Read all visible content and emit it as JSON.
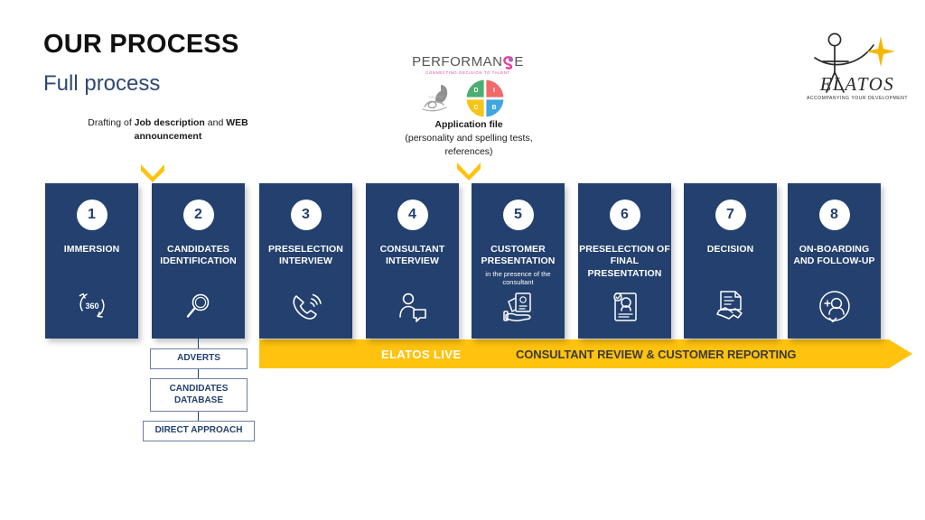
{
  "header": {
    "title": "OUR PROCESS",
    "subtitle": "Full process"
  },
  "notes": {
    "drafting": {
      "part1": "Drafting of ",
      "bold1": "Job description",
      "part2": " and ",
      "bold2": "WEB announcement"
    },
    "application": {
      "title": "Application file",
      "detail": "(personality and spelling tests, references)"
    }
  },
  "logos": {
    "performanse": {
      "wordmark": "PERFORMAN",
      "wordmark_end": "E",
      "tagline": "CONNECTING DECISION TO TALENT",
      "swirl_color": "#E5429B"
    },
    "disc": {
      "quadrants": [
        {
          "letter": "D",
          "color": "#4CAF72"
        },
        {
          "letter": "I",
          "color": "#F06A6A"
        },
        {
          "letter": "C",
          "color": "#F5C518"
        },
        {
          "letter": "B",
          "color": "#40A6E0"
        }
      ]
    },
    "script_logo": "Telfor",
    "elatos": {
      "name": "ELATOS",
      "tagline": "ACCOMPANYING YOUR DEVELOPMENT",
      "star_color": "#F5B800"
    }
  },
  "colors": {
    "navy": "#23406E",
    "yellow": "#FFC20E",
    "subtitle_blue": "#2e4a73"
  },
  "steps": [
    {
      "number": "1",
      "label": "IMMERSION",
      "sublabel": "",
      "icon": "rotate-360-icon"
    },
    {
      "number": "2",
      "label": "CANDIDATES IDENTIFICATION",
      "sublabel": "",
      "icon": "magnifier-icon"
    },
    {
      "number": "3",
      "label": "PRESELECTION INTERVIEW",
      "sublabel": "",
      "icon": "phone-call-icon"
    },
    {
      "number": "4",
      "label": "CONSULTANT INTERVIEW",
      "sublabel": "",
      "icon": "person-chat-icon"
    },
    {
      "number": "5",
      "label": "CUSTOMER PRESENTATION",
      "sublabel": "in the presence of the consultant",
      "icon": "hand-document-icon"
    },
    {
      "number": "6",
      "label": "PRESELECTION OF FINAL PRESENTATION",
      "sublabel": "",
      "icon": "checklist-person-icon"
    },
    {
      "number": "7",
      "label": "DECISION",
      "sublabel": "",
      "icon": "handshake-document-icon"
    },
    {
      "number": "8",
      "label": "ON-BOARDING AND FOLLOW-UP",
      "sublabel": "",
      "icon": "add-person-icon"
    }
  ],
  "banner": {
    "live_label": "ELATOS  LIVE",
    "review_label": "CONSULTANT REVIEW & CUSTOMER REPORTING"
  },
  "sub_boxes": [
    {
      "label": "ADVERTS"
    },
    {
      "label": "CANDIDATES DATABASE"
    },
    {
      "label": "DIRECT APPROACH"
    }
  ]
}
